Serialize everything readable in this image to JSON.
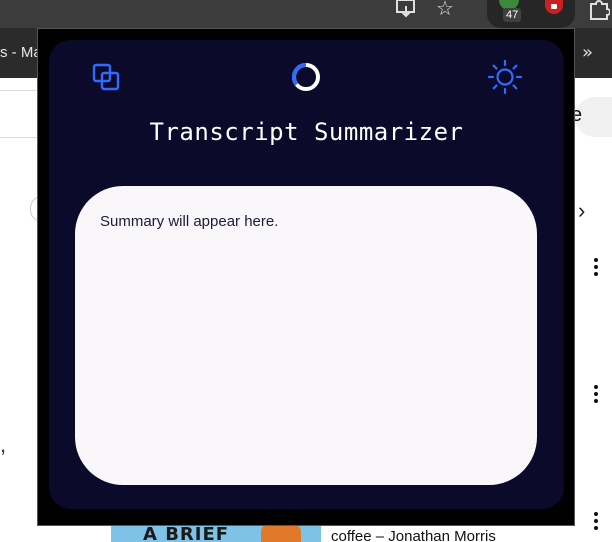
{
  "browser": {
    "tab_fragment": "s - Ma",
    "extension_badge": "47",
    "overflow_glyph": "»",
    "page_partial_button": "e",
    "page_mark": ",",
    "thumbnail_text": "A BRIEF",
    "bottom_text": "coffee – Jonathan Morris"
  },
  "popup": {
    "title": "Transcript Summarizer",
    "summary_placeholder": "Summary will appear here.",
    "icons": {
      "left": "copy-icon",
      "center": "loading-spinner-icon",
      "right": "sun-icon"
    },
    "colors": {
      "background": "#0b0a2b",
      "accent": "#2f6bff",
      "summary_bg": "#f9f7f9",
      "title_text": "#ffffff"
    }
  }
}
